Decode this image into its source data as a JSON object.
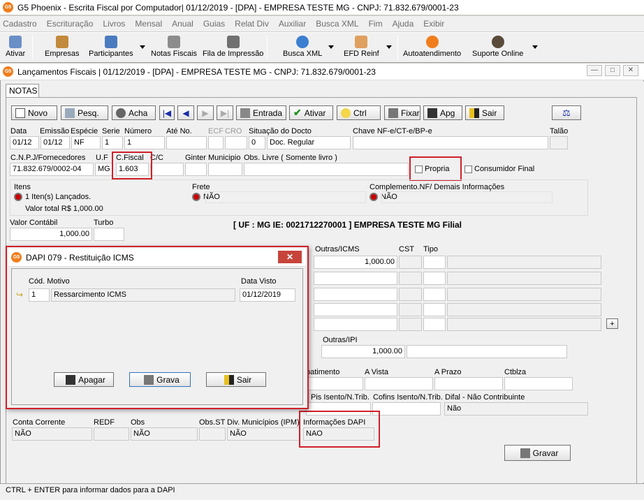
{
  "app": {
    "title": "G5 Phoenix - Escrita Fiscal por Computador|  01/12/2019 - [DPA] - EMPRESA TESTE MG - CNPJ: 71.832.679/0001-23",
    "logo": "G5"
  },
  "menu": [
    "Cadastro",
    "Escrituração",
    "Livros",
    "Mensal",
    "Anual",
    "Guias",
    "Relat Div",
    "Auxiliar",
    "Busca XML",
    "Fim",
    "Ajuda",
    "Exibir"
  ],
  "toolbar": {
    "ativar": "Ativar",
    "empresas": "Empresas",
    "participantes": "Participantes",
    "filas": "Notas Fiscais",
    "fila_impressao": "Fila de Impressão",
    "busca_xml": "Busca XML",
    "efd": "EFD Reinf",
    "autoatendimento": "Autoatendimento",
    "suporte": "Suporte Online"
  },
  "window": {
    "title": "Lançamentos Fiscais |  01/12/2019 - [DPA] - EMPRESA TESTE MG - CNPJ: 71.832.679/0001-23",
    "tab": "NOTAS"
  },
  "buttons": {
    "novo": "Novo",
    "pesq": "Pesq.",
    "acha": "Acha",
    "entrada": "Entrada",
    "ativar": "Ativar",
    "ctrl": "Ctrl",
    "fixar": "Fixar",
    "apg": "Apg",
    "sair": "Sair",
    "gravar": "Gravar"
  },
  "header": {
    "l_data": "Data",
    "l_emissao": "Emissão",
    "l_especie": "Espécie",
    "l_serie": "Serie",
    "l_numero": "Número",
    "l_ateno": "Até No.",
    "l_ecf": "ECF",
    "l_cro": "CRO",
    "l_situacao": "Situação do Docto",
    "l_chave": "Chave NF-e/CT-e/BP-e",
    "l_talao": "Talão",
    "data": "01/12",
    "emissao": "01/12",
    "especie": "NF",
    "serie": "1",
    "numero": "1",
    "situacao_cod": "0",
    "situacao": "Doc. Regular"
  },
  "row2": {
    "l_cnpj": "C.N.P.J/Fornecedores",
    "l_uf": "U.F",
    "l_cfiscal": "C.Fiscal",
    "l_cc": "C/C",
    "l_ginter": "Ginter",
    "l_municipio": "Municipio",
    "l_obs": "Obs. Livre ( Somente livro )",
    "cnpj": "71.832.679/0002-04",
    "uf": "MG",
    "cfiscal": "1.603",
    "propria": "Propria",
    "consumidor": "Consumidor Final"
  },
  "info": {
    "l_itens": "Itens",
    "itens": "1 Iten(s) Lançados.",
    "valor_total": "Valor total R$ 1,000.00",
    "l_frete": "Frete",
    "frete": "NÃO",
    "l_compl": "Complemento.NF/ Demais Informações",
    "compl": "NÃO"
  },
  "valores": {
    "l_contabil": "Valor Contábil",
    "l_turbo": "Turbo",
    "contabil": "1,000.00",
    "empresa": "[ UF : MG IE: 0021712270001 ] EMPRESA TESTE MG Filial"
  },
  "grid": {
    "l_outras": "Outras/ICMS",
    "l_cst": "CST",
    "l_tipo": "Tipo",
    "outras": "1,000.00",
    "add": "+"
  },
  "ipi": {
    "l_outras": "Outras/IPI",
    "outras": "1,000.00"
  },
  "pagamento": {
    "l_pagamento": "patimento",
    "l_vista": "A Vista",
    "l_prazo": "A Prazo",
    "l_ctblza": "Ctblza"
  },
  "pis": {
    "l_pis": "Pis Isento/N.Trib.",
    "l_cofins": "Cofins Isento/N.Trib.",
    "l_difal": "Difal - Não Contribuinte",
    "difal": "Não"
  },
  "bottom": {
    "l_conta": "Conta Corrente",
    "l_redf": "REDF",
    "l_obs": "Obs",
    "l_obsst": "Obs.ST",
    "l_div": "Div. Municípios (IPM)",
    "l_dapi": "Informações DAPI",
    "conta": "NÃO",
    "obs": "NÃO",
    "div": "NÃO",
    "dapi": "NAO"
  },
  "status": "CTRL + ENTER para informar dados para a DAPI",
  "dialog": {
    "title": "DAPI 079 - Restituição ICMS",
    "l_cod": "Cód. Motivo",
    "l_data": "Data Visto",
    "cod": "1",
    "motivo": "Ressarcimento ICMS",
    "data": "01/12/2019",
    "apagar": "Apagar",
    "grava": "Grava",
    "sair": "Sair",
    "close": "✕"
  }
}
